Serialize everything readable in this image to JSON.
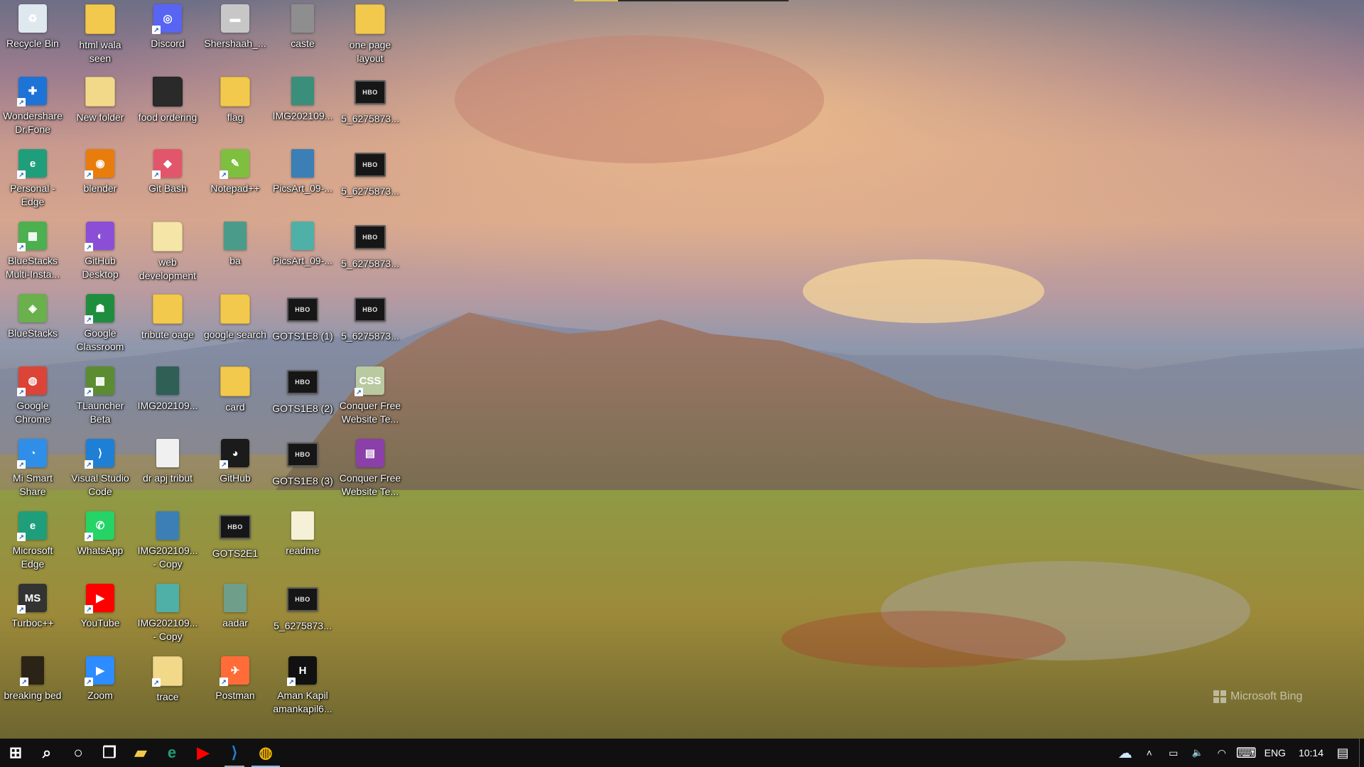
{
  "desktop": {
    "watermark": "Microsoft Bing",
    "icons": [
      {
        "label": "Recycle Bin",
        "name": "recycle-bin-icon",
        "kind": "app",
        "color": "#dfe8ee",
        "glyph": "♻",
        "shortcut": false
      },
      {
        "label": "html wala seen",
        "name": "html-folder-icon",
        "kind": "folder",
        "color": "#f2c94c",
        "glyph": "",
        "shortcut": false
      },
      {
        "label": "Discord",
        "name": "discord-icon",
        "kind": "app",
        "color": "#5865f2",
        "glyph": "◎",
        "shortcut": true
      },
      {
        "label": "Shershaah_...",
        "name": "video-file-icon",
        "kind": "app",
        "color": "#c7c7c7",
        "glyph": "▬",
        "shortcut": false
      },
      {
        "label": "caste",
        "name": "document-file-icon",
        "kind": "file",
        "color": "#8e8e8e",
        "glyph": "",
        "shortcut": false
      },
      {
        "label": "one page layout",
        "name": "one-page-folder-icon",
        "kind": "folder",
        "color": "#f2c94c",
        "glyph": "",
        "shortcut": false
      },
      {
        "label": "Wondershare Dr.Fone",
        "name": "drfone-icon",
        "kind": "app",
        "color": "#1e73d6",
        "glyph": "✚",
        "shortcut": true
      },
      {
        "label": "New folder",
        "name": "new-folder-icon",
        "kind": "folder",
        "color": "#f2d98a",
        "glyph": "",
        "shortcut": false
      },
      {
        "label": "food ordering",
        "name": "food-folder-icon",
        "kind": "folder",
        "color": "#2a2a2a",
        "glyph": "",
        "shortcut": false
      },
      {
        "label": "flag",
        "name": "flag-folder-icon",
        "kind": "folder",
        "color": "#f2c94c",
        "glyph": "",
        "shortcut": false
      },
      {
        "label": "IMG202109...",
        "name": "image-file-icon",
        "kind": "file",
        "color": "#3a8f7a",
        "glyph": "",
        "shortcut": false
      },
      {
        "label": "5_6275873...",
        "name": "hbo-video-icon",
        "kind": "video",
        "color": "#161616",
        "glyph": "HBO",
        "shortcut": false
      },
      {
        "label": "Personal - Edge",
        "name": "edge-profile-icon",
        "kind": "app",
        "color": "#1f9e7c",
        "glyph": "e",
        "shortcut": true
      },
      {
        "label": "blender",
        "name": "blender-icon",
        "kind": "app",
        "color": "#e87d0d",
        "glyph": "◉",
        "shortcut": true
      },
      {
        "label": "Git Bash",
        "name": "git-bash-icon",
        "kind": "app",
        "color": "#e2566c",
        "glyph": "◆",
        "shortcut": true
      },
      {
        "label": "Notepad++",
        "name": "notepad-plus-icon",
        "kind": "app",
        "color": "#7fbf3f",
        "glyph": "✎",
        "shortcut": true
      },
      {
        "label": "PicsArt_09-...",
        "name": "photo-file-icon",
        "kind": "file",
        "color": "#3b7fb6",
        "glyph": "",
        "shortcut": false
      },
      {
        "label": "5_6275873...",
        "name": "hbo-video-icon",
        "kind": "video",
        "color": "#161616",
        "glyph": "HBO",
        "shortcut": false
      },
      {
        "label": "BlueStacks Multi-Insta...",
        "name": "bluestacks-multi-icon",
        "kind": "app",
        "color": "#4caf50",
        "glyph": "▦",
        "shortcut": true
      },
      {
        "label": "GitHub Desktop",
        "name": "github-desktop-icon",
        "kind": "app",
        "color": "#8a4fd6",
        "glyph": "◐",
        "shortcut": true
      },
      {
        "label": "web development",
        "name": "web-dev-folder-icon",
        "kind": "folder",
        "color": "#f5e6a8",
        "glyph": "",
        "shortcut": false
      },
      {
        "label": "ba",
        "name": "ba-file-icon",
        "kind": "file",
        "color": "#4a9b8a",
        "glyph": "",
        "shortcut": false
      },
      {
        "label": "PicsArt_09-...",
        "name": "photo-file-icon",
        "kind": "file",
        "color": "#4fb0a8",
        "glyph": "",
        "shortcut": false
      },
      {
        "label": "5_6275873...",
        "name": "hbo-video-icon",
        "kind": "video",
        "color": "#161616",
        "glyph": "HBO",
        "shortcut": false
      },
      {
        "label": "BlueStacks",
        "name": "bluestacks-icon",
        "kind": "app",
        "color": "#6ab04c",
        "glyph": "◈",
        "shortcut": false
      },
      {
        "label": "Google Classroom",
        "name": "google-classroom-icon",
        "kind": "app",
        "color": "#1e8e3e",
        "glyph": "☗",
        "shortcut": true
      },
      {
        "label": "tribute oage",
        "name": "tribute-folder-icon",
        "kind": "folder",
        "color": "#f2c94c",
        "glyph": "",
        "shortcut": false
      },
      {
        "label": "google search",
        "name": "google-search-folder-icon",
        "kind": "folder",
        "color": "#f2c94c",
        "glyph": "",
        "shortcut": false
      },
      {
        "label": "GOTS1E8 (1)",
        "name": "hbo-video-icon",
        "kind": "video",
        "color": "#161616",
        "glyph": "HBO",
        "shortcut": false
      },
      {
        "label": "5_6275873...",
        "name": "hbo-video-icon",
        "kind": "video",
        "color": "#161616",
        "glyph": "HBO",
        "shortcut": false
      },
      {
        "label": "Google Chrome",
        "name": "google-chrome-icon",
        "kind": "app",
        "color": "#db4437",
        "glyph": "◍",
        "shortcut": true
      },
      {
        "label": "TLauncher Beta",
        "name": "tlauncher-icon",
        "kind": "app",
        "color": "#5b8c32",
        "glyph": "▩",
        "shortcut": true
      },
      {
        "label": "IMG202109...",
        "name": "image-file-icon",
        "kind": "file",
        "color": "#2f5f55",
        "glyph": "",
        "shortcut": false
      },
      {
        "label": "card",
        "name": "card-folder-icon",
        "kind": "folder",
        "color": "#f2c94c",
        "glyph": "",
        "shortcut": false
      },
      {
        "label": "GOTS1E8 (2)",
        "name": "hbo-video-icon",
        "kind": "video",
        "color": "#161616",
        "glyph": "HBO",
        "shortcut": false
      },
      {
        "label": "Conquer Free Website Te...",
        "name": "css-file-icon",
        "kind": "app",
        "color": "#b9c9a0",
        "glyph": "CSS",
        "shortcut": true
      },
      {
        "label": "Mi Smart Share",
        "name": "mi-smart-share-icon",
        "kind": "app",
        "color": "#2f8fe8",
        "glyph": "◔",
        "shortcut": true
      },
      {
        "label": "Visual Studio Code",
        "name": "vscode-icon",
        "kind": "app",
        "color": "#1f7fd4",
        "glyph": "⟩",
        "shortcut": true
      },
      {
        "label": "dr apj tribut",
        "name": "chrome-html-file-icon",
        "kind": "file",
        "color": "#f0f0f0",
        "glyph": "",
        "shortcut": false
      },
      {
        "label": "GitHub",
        "name": "github-icon",
        "kind": "app",
        "color": "#1b1b1b",
        "glyph": "◕",
        "shortcut": true
      },
      {
        "label": "GOTS1E8 (3)",
        "name": "hbo-video-icon",
        "kind": "video",
        "color": "#161616",
        "glyph": "HBO",
        "shortcut": false
      },
      {
        "label": "Conquer Free Website Te...",
        "name": "winrar-archive-icon",
        "kind": "app",
        "color": "#8b3fa8",
        "glyph": "▤",
        "shortcut": false
      },
      {
        "label": "Microsoft Edge",
        "name": "microsoft-edge-icon",
        "kind": "app",
        "color": "#1f9e7c",
        "glyph": "e",
        "shortcut": true
      },
      {
        "label": "WhatsApp",
        "name": "whatsapp-icon",
        "kind": "app",
        "color": "#25d366",
        "glyph": "✆",
        "shortcut": true
      },
      {
        "label": "IMG202109... - Copy",
        "name": "image-copy-file-icon",
        "kind": "file",
        "color": "#3b7fb6",
        "glyph": "",
        "shortcut": false
      },
      {
        "label": "GOTS2E1",
        "name": "hbo-video-icon",
        "kind": "video",
        "color": "#161616",
        "glyph": "HBO",
        "shortcut": false
      },
      {
        "label": "readme",
        "name": "readme-file-icon",
        "kind": "file",
        "color": "#f5f0d8",
        "glyph": "",
        "shortcut": false
      },
      {
        "label": "Turboc++",
        "name": "turbo-cpp-icon",
        "kind": "app",
        "color": "#333333",
        "glyph": "MS",
        "shortcut": true
      },
      {
        "label": "YouTube",
        "name": "youtube-icon",
        "kind": "app",
        "color": "#ff0000",
        "glyph": "▶",
        "shortcut": true
      },
      {
        "label": "IMG202109... - Copy",
        "name": "image-copy-file-icon",
        "kind": "file",
        "color": "#4fb0a8",
        "glyph": "",
        "shortcut": false
      },
      {
        "label": "aadar",
        "name": "aadhar-file-icon",
        "kind": "file",
        "color": "#6f9f8a",
        "glyph": "",
        "shortcut": false
      },
      {
        "label": "5_6275873...",
        "name": "hbo-video-icon",
        "kind": "video",
        "color": "#161616",
        "glyph": "HBO",
        "shortcut": false
      },
      {
        "label": "breaking bed",
        "name": "breaking-bad-file-icon",
        "kind": "file",
        "color": "#2b2416",
        "glyph": "",
        "shortcut": true
      },
      {
        "label": "Zoom",
        "name": "zoom-icon",
        "kind": "app",
        "color": "#2d8cff",
        "glyph": "▶",
        "shortcut": true
      },
      {
        "label": "trace",
        "name": "trace-folder-icon",
        "kind": "folder",
        "color": "#f2d98a",
        "glyph": "",
        "shortcut": true
      },
      {
        "label": "Postman",
        "name": "postman-icon",
        "kind": "app",
        "color": "#ff6c37",
        "glyph": "✈",
        "shortcut": true
      },
      {
        "label": "Aman Kapil amankapil6...",
        "name": "hackerrank-icon",
        "kind": "app",
        "color": "#111111",
        "glyph": "H",
        "shortcut": true
      }
    ]
  },
  "taskbar": {
    "apps": [
      {
        "name": "start-button",
        "glyph": "⊞",
        "color": "#ffffff",
        "state": ""
      },
      {
        "name": "search-icon",
        "glyph": "⌕",
        "color": "#ffffff",
        "state": ""
      },
      {
        "name": "cortana-icon",
        "glyph": "○",
        "color": "#ffffff",
        "state": ""
      },
      {
        "name": "task-view-icon",
        "glyph": "❐",
        "color": "#ffffff",
        "state": ""
      },
      {
        "name": "file-explorer-icon",
        "glyph": "▰",
        "color": "#f2c94c",
        "state": ""
      },
      {
        "name": "edge-taskbar-icon",
        "glyph": "e",
        "color": "#1f9e7c",
        "state": ""
      },
      {
        "name": "youtube-taskbar-icon",
        "glyph": "▶",
        "color": "#ff0000",
        "state": ""
      },
      {
        "name": "vscode-taskbar-icon",
        "glyph": "⟩",
        "color": "#1f7fd4",
        "state": "running"
      },
      {
        "name": "chrome-taskbar-icon",
        "glyph": "◍",
        "color": "#f4b400",
        "state": "active"
      }
    ],
    "tray": {
      "onedrive_glyph": "☁",
      "chevron_glyph": "˄",
      "battery_glyph": "▭",
      "volume_glyph": "🔈",
      "wifi_glyph": "◠",
      "keyboard_glyph": "⌨",
      "language": "ENG",
      "time": "10:14",
      "notification_glyph": "▤"
    }
  }
}
